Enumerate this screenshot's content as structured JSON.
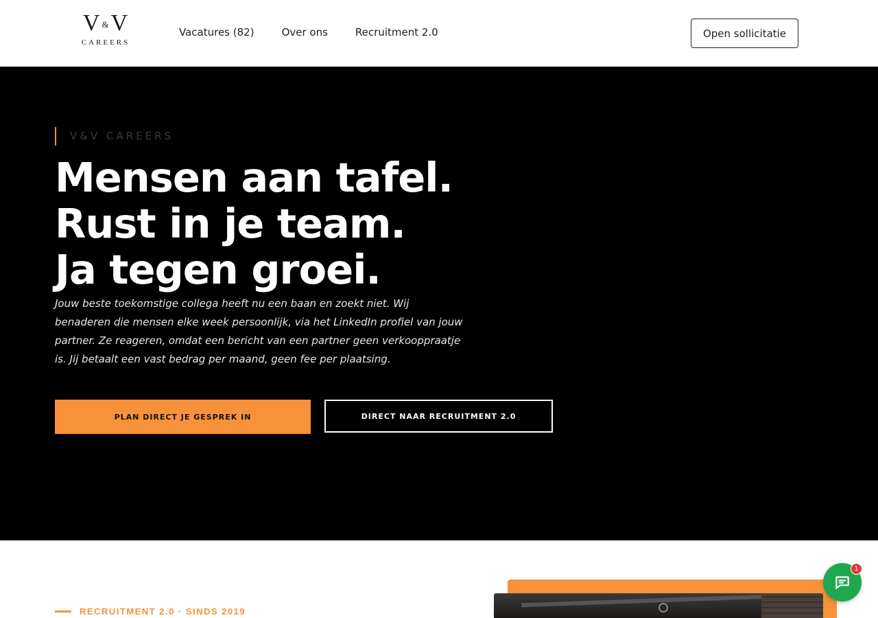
{
  "header": {
    "logo": {
      "mark_left": "V",
      "mark_amp": "&",
      "mark_right": "V",
      "sub": "CAREERS"
    },
    "nav": [
      {
        "label": "Vacatures (82)"
      },
      {
        "label": "Over ons"
      },
      {
        "label": "Recruitment 2.0"
      }
    ],
    "cta_label": "Open sollicitatie"
  },
  "hero": {
    "eyebrow": "V&V CAREERS",
    "headline": [
      "Mensen aan tafel.",
      "Rust in je team.",
      "Ja tegen groei."
    ],
    "intro": "Jouw beste toekomstige collega heeft nu een baan en zoekt niet. Wij benaderen die mensen elke week persoonlijk, via het LinkedIn profiel van jouw partner. Ze reageren, omdat een bericht van een partner geen verkooppraatje is. Jij betaalt een vast bedrag per maand, geen fee per plaatsing.",
    "primary_button": "PLAN DIRECT JE GESPREK IN",
    "secondary_button": "DIRECT NAAR RECRUITMENT 2.0"
  },
  "section": {
    "label": "RECRUITMENT 2.0 · SINDS 2019"
  },
  "chat": {
    "icon": "chat-bubble-icon",
    "badge": "1"
  },
  "colors": {
    "accent": "#f7913a",
    "hero_bg": "#000000",
    "chat_green": "#1fa84f",
    "badge_red": "#e53935"
  }
}
